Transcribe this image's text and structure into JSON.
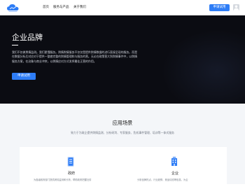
{
  "header": {
    "logo": "cloud-logo-icon",
    "nav": [
      "首页",
      "服务与产品",
      "关于我们"
    ],
    "trial_label": "申请试用",
    "avatar": "user-avatar-icon"
  },
  "hero": {
    "title": "企业品牌",
    "description": "我们不仅做舆情监测。我们更懂服务。舆情舆情服务不仅仅是提供舆情数据的进行直接呈现的服务。而是在数据分析后对应对于提供一整套完整的舆情管理和与服务的营。无论在政策营大到舆情事件中，以舆情服务方案，在治象与商业冲突，以舆情应对方式发挥最佳正营的作用。",
    "button_label": "申请试用"
  },
  "scenarios": {
    "title": "应用场景",
    "subtitle": "致力于为政企提供舆情监测、分析研判、专家服务、危机事件管理、培训等一体式服务",
    "cards": [
      {
        "title": "政府",
        "description": "为各级政府部门提供舆情监测和分析，帮助政府把握社情",
        "icon": "document-stack-icon"
      },
      {
        "title": "企业",
        "description": "分析品牌热点、行业趋势、竞品动态等信息，为企",
        "icon": "building-icon"
      }
    ]
  },
  "colors": {
    "accent": "#2e7df6",
    "hero_bg": "#0b0c12",
    "section_bg": "#f4f6f9"
  }
}
